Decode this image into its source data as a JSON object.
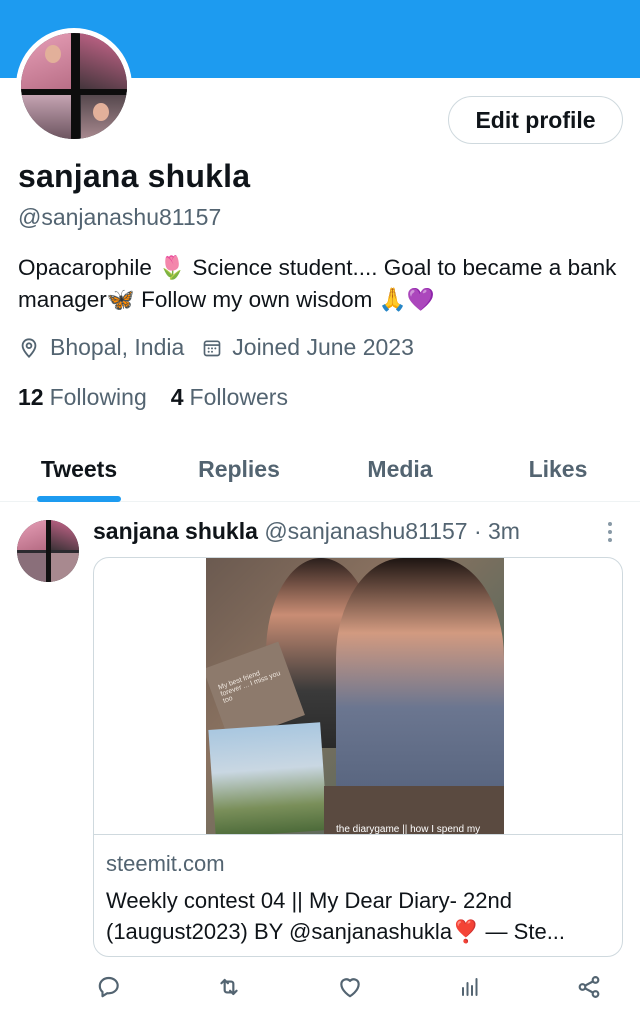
{
  "profile": {
    "name": "sanjana shukla",
    "handle": "@sanjanashu81157",
    "edit_label": "Edit profile",
    "bio": "Opacarophile 🌷 Science student.... Goal to became a bank manager🦋 Follow my own wisdom 🙏💜",
    "location": "Bhopal, India",
    "joined": "Joined June 2023",
    "following_count": "12",
    "following_label": "Following",
    "followers_count": "4",
    "followers_label": "Followers"
  },
  "tabs": [
    {
      "label": "Tweets",
      "active": true
    },
    {
      "label": "Replies",
      "active": false
    },
    {
      "label": "Media",
      "active": false
    },
    {
      "label": "Likes",
      "active": false
    }
  ],
  "tweet": {
    "author": "sanjana shukla",
    "handle_time": "@sanjanashu81157 · 3m",
    "card_image_note": "My best friend forever ... I miss you too",
    "card_image_caption": "the diarygame || how I spend my",
    "card_domain": "steemit.com",
    "card_title": "Weekly contest 04 || My Dear Diary- 22nd (1august2023) BY @sanjanashukla❣️ — Ste..."
  },
  "icons": {
    "location": "map-pin-icon",
    "joined": "calendar-icon",
    "reply": "reply-icon",
    "retweet": "retweet-icon",
    "like": "heart-icon",
    "views": "analytics-icon",
    "share": "share-icon",
    "more": "more-icon"
  },
  "colors": {
    "accent": "#1d9bf0",
    "secondary_text": "#536471"
  }
}
